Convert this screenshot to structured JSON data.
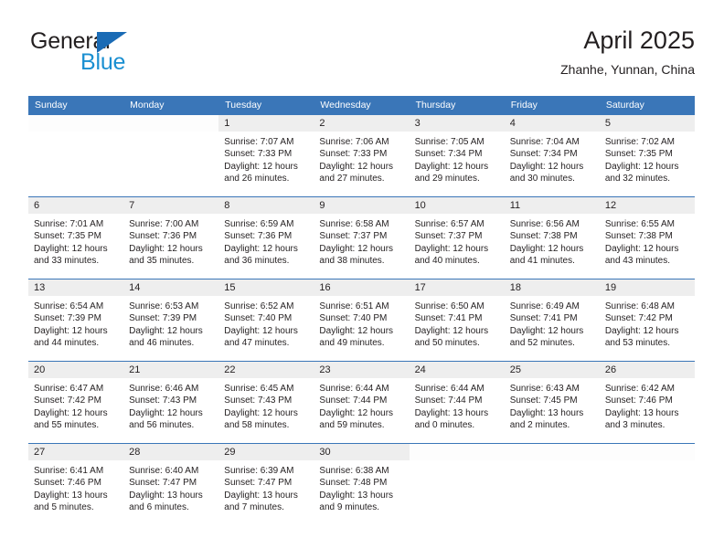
{
  "brand": {
    "name_part1": "General",
    "name_part2": "Blue",
    "triangle_icon": "triangle-icon",
    "color_dark": "#231f20",
    "color_blue": "#1a8fd1",
    "color_triangle": "#1a6bb5"
  },
  "header": {
    "title": "April 2025",
    "subtitle": "Zhanhe, Yunnan, China"
  },
  "theme": {
    "header_bar": "#3a76b8",
    "day_strip": "#eeeeee",
    "row_divider": "#3a76b8",
    "text": "#231f20"
  },
  "weekdays": [
    "Sunday",
    "Monday",
    "Tuesday",
    "Wednesday",
    "Thursday",
    "Friday",
    "Saturday"
  ],
  "weeks": [
    [
      {
        "day": "",
        "lines": []
      },
      {
        "day": "",
        "lines": []
      },
      {
        "day": "1",
        "lines": [
          "Sunrise: 7:07 AM",
          "Sunset: 7:33 PM",
          "Daylight: 12 hours",
          "and 26 minutes."
        ]
      },
      {
        "day": "2",
        "lines": [
          "Sunrise: 7:06 AM",
          "Sunset: 7:33 PM",
          "Daylight: 12 hours",
          "and 27 minutes."
        ]
      },
      {
        "day": "3",
        "lines": [
          "Sunrise: 7:05 AM",
          "Sunset: 7:34 PM",
          "Daylight: 12 hours",
          "and 29 minutes."
        ]
      },
      {
        "day": "4",
        "lines": [
          "Sunrise: 7:04 AM",
          "Sunset: 7:34 PM",
          "Daylight: 12 hours",
          "and 30 minutes."
        ]
      },
      {
        "day": "5",
        "lines": [
          "Sunrise: 7:02 AM",
          "Sunset: 7:35 PM",
          "Daylight: 12 hours",
          "and 32 minutes."
        ]
      }
    ],
    [
      {
        "day": "6",
        "lines": [
          "Sunrise: 7:01 AM",
          "Sunset: 7:35 PM",
          "Daylight: 12 hours",
          "and 33 minutes."
        ]
      },
      {
        "day": "7",
        "lines": [
          "Sunrise: 7:00 AM",
          "Sunset: 7:36 PM",
          "Daylight: 12 hours",
          "and 35 minutes."
        ]
      },
      {
        "day": "8",
        "lines": [
          "Sunrise: 6:59 AM",
          "Sunset: 7:36 PM",
          "Daylight: 12 hours",
          "and 36 minutes."
        ]
      },
      {
        "day": "9",
        "lines": [
          "Sunrise: 6:58 AM",
          "Sunset: 7:37 PM",
          "Daylight: 12 hours",
          "and 38 minutes."
        ]
      },
      {
        "day": "10",
        "lines": [
          "Sunrise: 6:57 AM",
          "Sunset: 7:37 PM",
          "Daylight: 12 hours",
          "and 40 minutes."
        ]
      },
      {
        "day": "11",
        "lines": [
          "Sunrise: 6:56 AM",
          "Sunset: 7:38 PM",
          "Daylight: 12 hours",
          "and 41 minutes."
        ]
      },
      {
        "day": "12",
        "lines": [
          "Sunrise: 6:55 AM",
          "Sunset: 7:38 PM",
          "Daylight: 12 hours",
          "and 43 minutes."
        ]
      }
    ],
    [
      {
        "day": "13",
        "lines": [
          "Sunrise: 6:54 AM",
          "Sunset: 7:39 PM",
          "Daylight: 12 hours",
          "and 44 minutes."
        ]
      },
      {
        "day": "14",
        "lines": [
          "Sunrise: 6:53 AM",
          "Sunset: 7:39 PM",
          "Daylight: 12 hours",
          "and 46 minutes."
        ]
      },
      {
        "day": "15",
        "lines": [
          "Sunrise: 6:52 AM",
          "Sunset: 7:40 PM",
          "Daylight: 12 hours",
          "and 47 minutes."
        ]
      },
      {
        "day": "16",
        "lines": [
          "Sunrise: 6:51 AM",
          "Sunset: 7:40 PM",
          "Daylight: 12 hours",
          "and 49 minutes."
        ]
      },
      {
        "day": "17",
        "lines": [
          "Sunrise: 6:50 AM",
          "Sunset: 7:41 PM",
          "Daylight: 12 hours",
          "and 50 minutes."
        ]
      },
      {
        "day": "18",
        "lines": [
          "Sunrise: 6:49 AM",
          "Sunset: 7:41 PM",
          "Daylight: 12 hours",
          "and 52 minutes."
        ]
      },
      {
        "day": "19",
        "lines": [
          "Sunrise: 6:48 AM",
          "Sunset: 7:42 PM",
          "Daylight: 12 hours",
          "and 53 minutes."
        ]
      }
    ],
    [
      {
        "day": "20",
        "lines": [
          "Sunrise: 6:47 AM",
          "Sunset: 7:42 PM",
          "Daylight: 12 hours",
          "and 55 minutes."
        ]
      },
      {
        "day": "21",
        "lines": [
          "Sunrise: 6:46 AM",
          "Sunset: 7:43 PM",
          "Daylight: 12 hours",
          "and 56 minutes."
        ]
      },
      {
        "day": "22",
        "lines": [
          "Sunrise: 6:45 AM",
          "Sunset: 7:43 PM",
          "Daylight: 12 hours",
          "and 58 minutes."
        ]
      },
      {
        "day": "23",
        "lines": [
          "Sunrise: 6:44 AM",
          "Sunset: 7:44 PM",
          "Daylight: 12 hours",
          "and 59 minutes."
        ]
      },
      {
        "day": "24",
        "lines": [
          "Sunrise: 6:44 AM",
          "Sunset: 7:44 PM",
          "Daylight: 13 hours",
          "and 0 minutes."
        ]
      },
      {
        "day": "25",
        "lines": [
          "Sunrise: 6:43 AM",
          "Sunset: 7:45 PM",
          "Daylight: 13 hours",
          "and 2 minutes."
        ]
      },
      {
        "day": "26",
        "lines": [
          "Sunrise: 6:42 AM",
          "Sunset: 7:46 PM",
          "Daylight: 13 hours",
          "and 3 minutes."
        ]
      }
    ],
    [
      {
        "day": "27",
        "lines": [
          "Sunrise: 6:41 AM",
          "Sunset: 7:46 PM",
          "Daylight: 13 hours",
          "and 5 minutes."
        ]
      },
      {
        "day": "28",
        "lines": [
          "Sunrise: 6:40 AM",
          "Sunset: 7:47 PM",
          "Daylight: 13 hours",
          "and 6 minutes."
        ]
      },
      {
        "day": "29",
        "lines": [
          "Sunrise: 6:39 AM",
          "Sunset: 7:47 PM",
          "Daylight: 13 hours",
          "and 7 minutes."
        ]
      },
      {
        "day": "30",
        "lines": [
          "Sunrise: 6:38 AM",
          "Sunset: 7:48 PM",
          "Daylight: 13 hours",
          "and 9 minutes."
        ]
      },
      {
        "day": "",
        "lines": []
      },
      {
        "day": "",
        "lines": []
      },
      {
        "day": "",
        "lines": []
      }
    ]
  ]
}
